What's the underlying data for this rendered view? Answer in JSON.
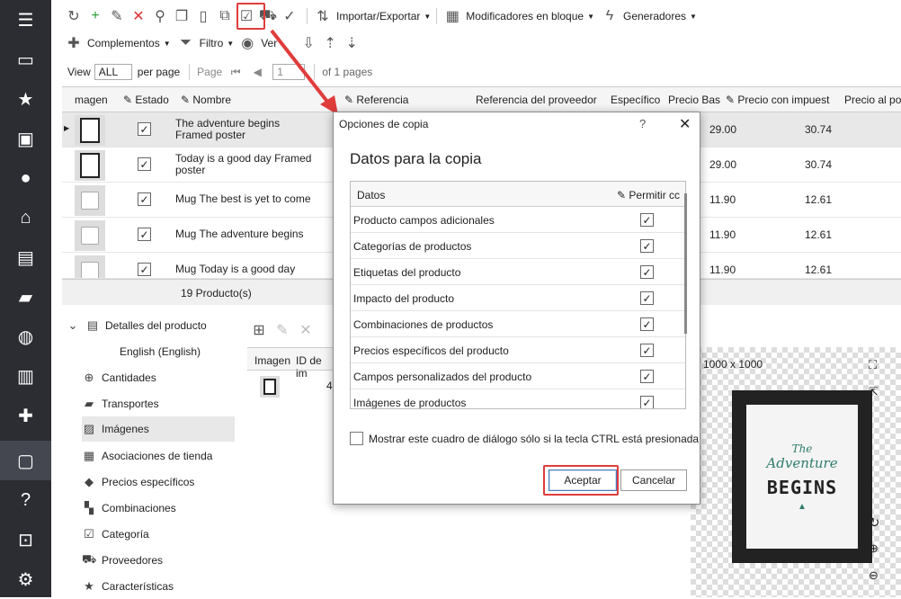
{
  "sidebar": {
    "icons": [
      "menu-icon",
      "store-icon",
      "star-icon",
      "box-icon",
      "user-icon",
      "basket-icon",
      "chat-icon",
      "truck-icon",
      "globe-icon",
      "chart-icon",
      "puzzle-icon",
      "archive-icon",
      "help-icon",
      "lock-icon",
      "gear-icon"
    ]
  },
  "toolbar": {
    "import_export": "Importar/Exportar",
    "bulk_modifiers": "Modificadores en bloque",
    "generators": "Generadores",
    "addons": "Complementos",
    "filter": "Filtro",
    "view": "Ver"
  },
  "pager": {
    "view_label": "View",
    "view_value": "ALL",
    "per_page": "per page",
    "page_label": "Page",
    "page_value": "1",
    "of_pages": "of 1 pages"
  },
  "grid": {
    "headers": {
      "image": "magen",
      "status": "Estado",
      "name": "Nombre",
      "reference": "Referencia",
      "supplier_ref": "Referencia del proveedor",
      "specific": "Específico",
      "base_price": "Precio Bas",
      "price_tax": "Precio con impuest",
      "final_price": "Precio al po"
    },
    "rows": [
      {
        "name": "The adventure begins Framed poster",
        "base": "29.00",
        "tax": "30.74"
      },
      {
        "name": "Today is a good day Framed poster",
        "base": "29.00",
        "tax": "30.74"
      },
      {
        "name": "Mug The best is yet to come",
        "base": "11.90",
        "tax": "12.61"
      },
      {
        "name": "Mug The adventure begins",
        "base": "11.90",
        "tax": "12.61"
      },
      {
        "name": "Mug Today is a good day",
        "base": "11.90",
        "tax": "12.61"
      }
    ],
    "footer": "19 Producto(s)"
  },
  "tree": {
    "root": "Detalles del producto",
    "lang": "English (English)",
    "items": [
      "Cantidades",
      "Transportes",
      "Imágenes",
      "Asociaciones de tienda",
      "Precios específicos",
      "Combinaciones",
      "Categoría",
      "Proveedores",
      "Características"
    ]
  },
  "subgrid": {
    "col_image": "Imagen",
    "col_id": "ID de im",
    "id_value": "4"
  },
  "image_panel": {
    "size": "1000 x 1000",
    "poster_line1": "The",
    "poster_line2": "Adventure",
    "poster_line3": "BEGINS"
  },
  "dialog": {
    "title": "Opciones de copia",
    "help": "?",
    "close": "✕",
    "heading": "Datos para la copia",
    "col_data": "Datos",
    "col_allow": "Permitir cc",
    "rows": [
      "Producto campos adicionales",
      "Categorías de productos",
      "Etiquetas del producto",
      "Impacto del producto",
      "Combinaciones de productos",
      "Precios específicos del producto",
      "Campos personalizados del producto",
      "Imágenes de productos"
    ],
    "option": "Mostrar este cuadro de diálogo sólo si la tecla CTRL está presionada",
    "accept": "Aceptar",
    "cancel": "Cancelar"
  },
  "colors": {
    "sidebar": "#2b2d33",
    "highlight": "#e03c3c"
  }
}
